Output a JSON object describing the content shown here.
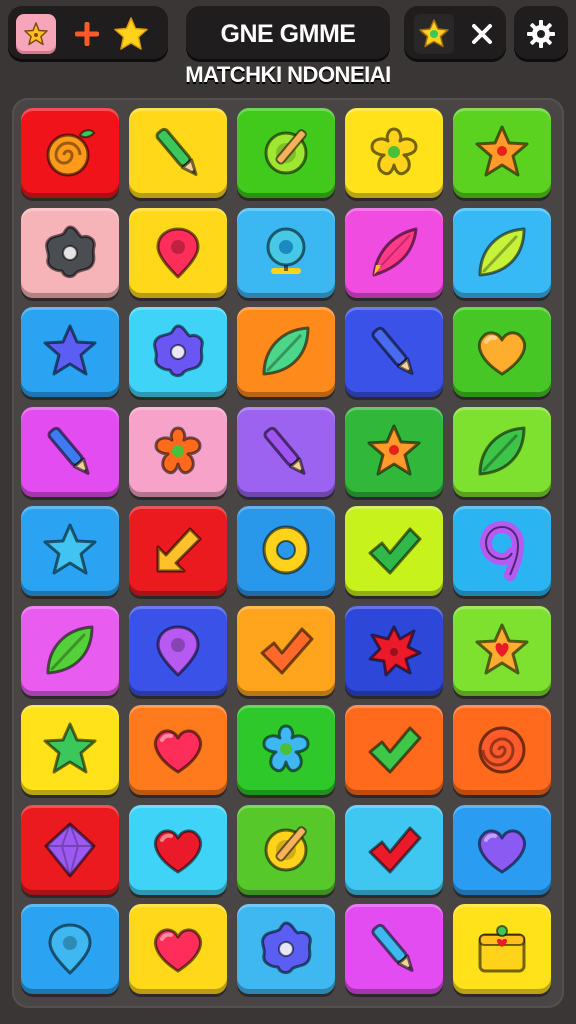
{
  "header": {
    "title": "GNE GMME",
    "subtitle": "MATCHKI NDONEIAI",
    "left_icons": [
      "pink-star-box-icon",
      "plus-icon",
      "gold-star-icon"
    ],
    "right_icons": [
      "star-chip-icon",
      "close-icon"
    ],
    "settings_icon": "gear-icon"
  },
  "board": {
    "columns": 5,
    "rows": 9,
    "tiles": [
      {
        "bg": "#f0141a",
        "icon": "swirl-fruit",
        "color": "#ff9a1a"
      },
      {
        "bg": "#ffd81a",
        "icon": "pencil",
        "color": "#3cc75a"
      },
      {
        "bg": "#41c91c",
        "icon": "circle-pencil",
        "color": "#9fe831"
      },
      {
        "bg": "#ffe21a",
        "icon": "flower",
        "color": "#ffd21c"
      },
      {
        "bg": "#5bd21f",
        "icon": "star-dot",
        "color": "#ff9a2b"
      },
      {
        "bg": "#f7b4b8",
        "icon": "blob-ring",
        "color": "#4a4d52"
      },
      {
        "bg": "#ffd81a",
        "icon": "drop",
        "color": "#ff2d5a"
      },
      {
        "bg": "#3bb8f2",
        "icon": "ring-stand",
        "color": "#47c9e6"
      },
      {
        "bg": "#f04ce0",
        "icon": "feather",
        "color": "#ff3a8a"
      },
      {
        "bg": "#36b9f4",
        "icon": "leaf",
        "color": "#c6f23a"
      },
      {
        "bg": "#2aa4f2",
        "icon": "star",
        "color": "#5a5ef2"
      },
      {
        "bg": "#3fd3f7",
        "icon": "blob-ring",
        "color": "#6a56f2"
      },
      {
        "bg": "#ff8a1c",
        "icon": "leaf",
        "color": "#4cd68a"
      },
      {
        "bg": "#3a52e8",
        "icon": "pencil",
        "color": "#4a6af0"
      },
      {
        "bg": "#46c726",
        "icon": "heart",
        "color": "#ffad2e"
      },
      {
        "bg": "#e24cf0",
        "icon": "pencil",
        "color": "#3f7af2"
      },
      {
        "bg": "#f7a2c8",
        "icon": "flower",
        "color": "#ff6a1c"
      },
      {
        "bg": "#9c62f0",
        "icon": "pencil",
        "color": "#a055f2"
      },
      {
        "bg": "#31b83a",
        "icon": "star-dot",
        "color": "#ff9a2b"
      },
      {
        "bg": "#7ee02f",
        "icon": "leaf",
        "color": "#3fc44a"
      },
      {
        "bg": "#2aa4f2",
        "icon": "star",
        "color": "#42c4f2"
      },
      {
        "bg": "#ea1a1f",
        "icon": "arrow",
        "color": "#ffc12a"
      },
      {
        "bg": "#2a98ea",
        "icon": "donut",
        "color": "#ffd21c"
      },
      {
        "bg": "#c8f21c",
        "icon": "check",
        "color": "#31b84a"
      },
      {
        "bg": "#2ab4f2",
        "icon": "nine",
        "color": "#b65af2"
      },
      {
        "bg": "#e85cf0",
        "icon": "leaf",
        "color": "#54d13a"
      },
      {
        "bg": "#3a52e8",
        "icon": "drop",
        "color": "#b65af2"
      },
      {
        "bg": "#ffa41c",
        "icon": "check",
        "color": "#ff6a2a"
      },
      {
        "bg": "#2d48d8",
        "icon": "splat",
        "color": "#ea1a2a"
      },
      {
        "bg": "#7ee02f",
        "icon": "star-heart",
        "color": "#ffad2e"
      },
      {
        "bg": "#ffe21a",
        "icon": "star",
        "color": "#3cc75a"
      },
      {
        "bg": "#ff7a1c",
        "icon": "heart",
        "color": "#ff2d5a"
      },
      {
        "bg": "#2fc82a",
        "icon": "flower",
        "color": "#3fb8f2"
      },
      {
        "bg": "#ff6a1c",
        "icon": "check",
        "color": "#3fc74a"
      },
      {
        "bg": "#ff6a1c",
        "icon": "spiral",
        "color": "#ff5a2a"
      },
      {
        "bg": "#ea1a1f",
        "icon": "diamond",
        "color": "#9c5af2"
      },
      {
        "bg": "#3fd3f7",
        "icon": "heart",
        "color": "#ea1a2a"
      },
      {
        "bg": "#56c82a",
        "icon": "circle-pencil",
        "color": "#ffd21c"
      },
      {
        "bg": "#3fc7f2",
        "icon": "check",
        "color": "#ea1a2a"
      },
      {
        "bg": "#2a9cf2",
        "icon": "heart",
        "color": "#8a5af2"
      },
      {
        "bg": "#2aa4f2",
        "icon": "drop",
        "color": "#3fb8f2"
      },
      {
        "bg": "#ffd81a",
        "icon": "heart",
        "color": "#ff2d5a"
      },
      {
        "bg": "#3fb8f2",
        "icon": "blob-ring",
        "color": "#5a5ef2"
      },
      {
        "bg": "#e24cf0",
        "icon": "pencil",
        "color": "#3fb8f2"
      },
      {
        "bg": "#ffe21a",
        "icon": "box",
        "color": "#ffd21c"
      }
    ]
  }
}
